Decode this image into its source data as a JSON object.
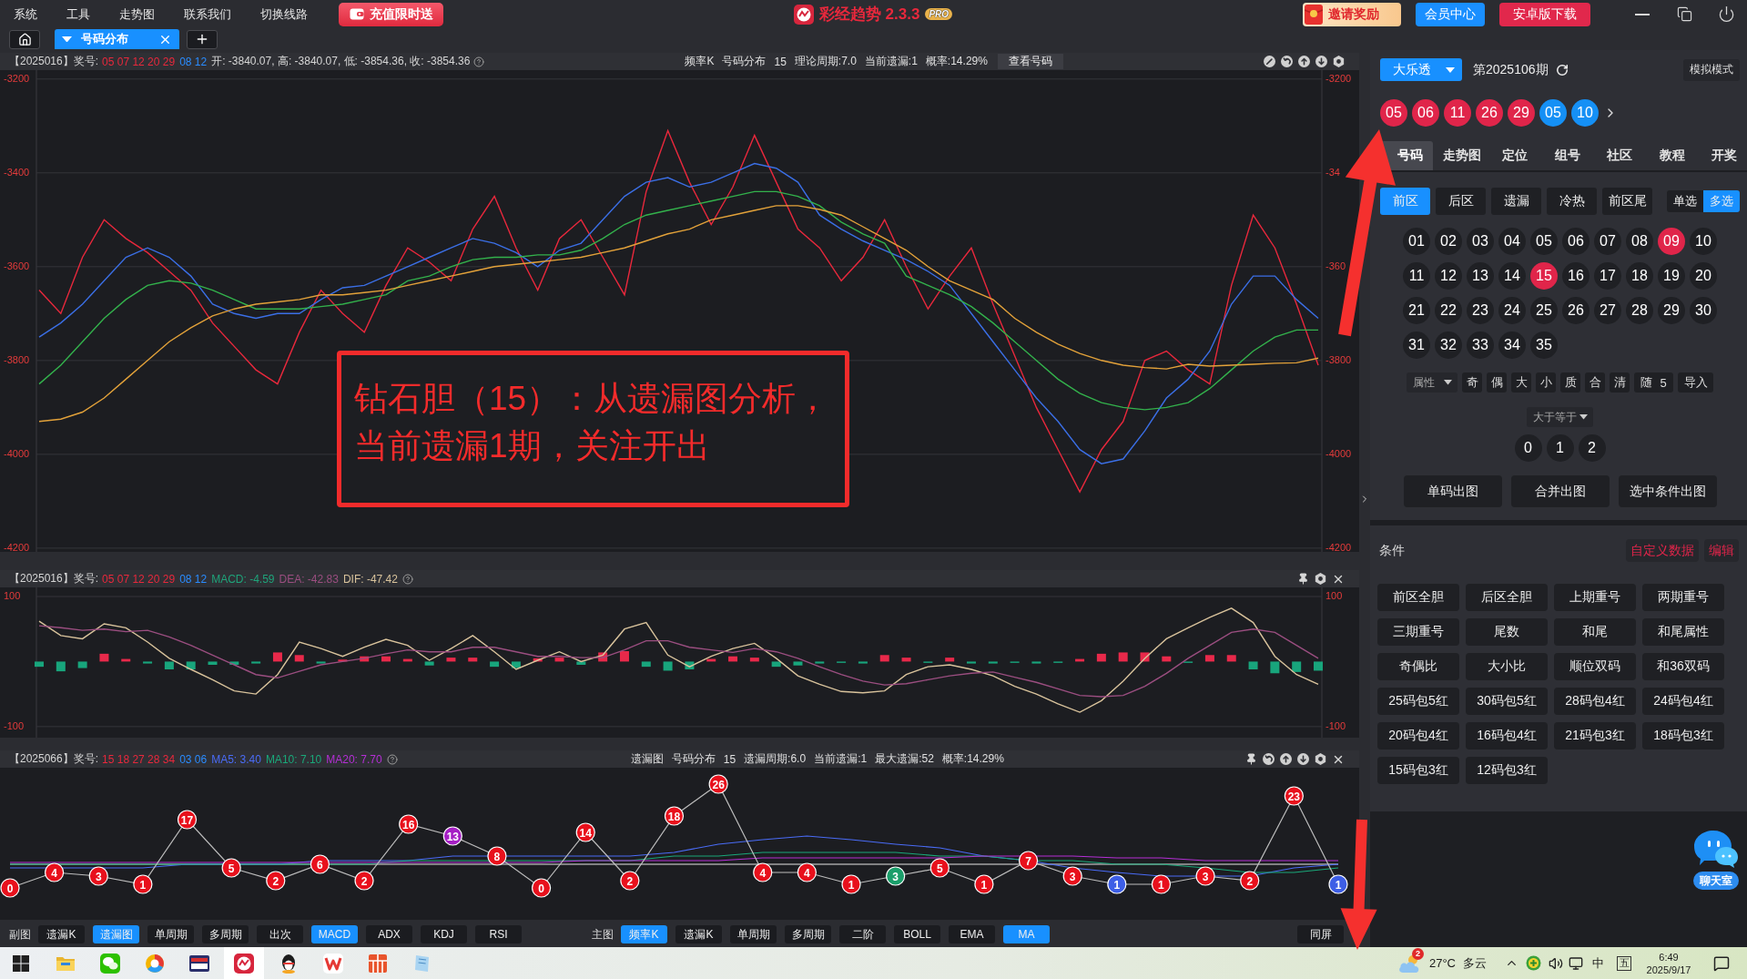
{
  "menu_bar": {
    "items": [
      "系统",
      "工具",
      "走势图",
      "联系我们",
      "切换线路"
    ],
    "promo_button": "充值限时送",
    "logo": {
      "title": "彩经趋势 2.3.3",
      "badge": "PRO"
    },
    "buttons": [
      {
        "label": "邀请奖励",
        "kind": "gift"
      },
      {
        "label": "会员中心",
        "kind": "primary"
      },
      {
        "label": "安卓版下载",
        "kind": "danger"
      }
    ]
  },
  "tab_bar": {
    "tabs": [
      {
        "label": "号码分布",
        "selected": true
      }
    ]
  },
  "chart_panels": [
    {
      "header": {
        "issue": "【2025016】奖号:",
        "front_numbers": "05 07 12 20 29",
        "back_numbers": "08 12",
        "ohlc": "开: -3840.07, 高: -3840.07, 低: -3854.36, 收: -3854.36",
        "info": [
          "频率K",
          "号码分布",
          "15",
          "理论周期:7.0",
          "当前遗漏:1",
          "概率:14.29%"
        ],
        "view_button": "查看号码"
      },
      "chart_data": {
        "type": "line",
        "grid": true,
        "ylim": [
          -4208,
          -3181
        ],
        "yticks": [
          -3200,
          -3400,
          -3600,
          -3800,
          -4000,
          -4200
        ],
        "series": [
          {
            "color": "#e8283c",
            "values": [
              -3650,
              -3700,
              -3580,
              -3500,
              -3540,
              -3570,
              -3610,
              -3650,
              -3720,
              -3770,
              -3820,
              -3850,
              -3740,
              -3650,
              -3700,
              -3740,
              -3640,
              -3560,
              -3590,
              -3630,
              -3520,
              -3450,
              -3560,
              -3650,
              -3540,
              -3500,
              -3580,
              -3660,
              -3440,
              -3310,
              -3420,
              -3510,
              -3430,
              -3320,
              -3420,
              -3520,
              -3560,
              -3630,
              -3580,
              -3500,
              -3600,
              -3690,
              -3620,
              -3560,
              -3680,
              -3790,
              -3900,
              -3990,
              -4080,
              -3990,
              -3930,
              -3800,
              -3780,
              -3820,
              -3850,
              -3640,
              -3490,
              -3560,
              -3680,
              -3810
            ]
          },
          {
            "color": "#3b6fe6",
            "values": [
              -3750,
              -3720,
              -3680,
              -3630,
              -3580,
              -3560,
              -3580,
              -3620,
              -3680,
              -3700,
              -3710,
              -3700,
              -3700,
              -3670,
              -3645,
              -3640,
              -3620,
              -3600,
              -3580,
              -3560,
              -3540,
              -3550,
              -3570,
              -3600,
              -3565,
              -3550,
              -3500,
              -3450,
              -3420,
              -3410,
              -3430,
              -3420,
              -3400,
              -3380,
              -3390,
              -3420,
              -3490,
              -3520,
              -3545,
              -3565,
              -3585,
              -3610,
              -3640,
              -3700,
              -3760,
              -3820,
              -3880,
              -3930,
              -3990,
              -4020,
              -4010,
              -3950,
              -3880,
              -3840,
              -3780,
              -3680,
              -3620,
              -3620,
              -3670,
              -3710
            ]
          },
          {
            "color": "#33b24c",
            "values": [
              -3850,
              -3810,
              -3760,
              -3710,
              -3670,
              -3640,
              -3630,
              -3635,
              -3650,
              -3670,
              -3690,
              -3690,
              -3690,
              -3685,
              -3680,
              -3670,
              -3660,
              -3630,
              -3620,
              -3600,
              -3585,
              -3580,
              -3580,
              -3575,
              -3575,
              -3565,
              -3540,
              -3510,
              -3490,
              -3480,
              -3470,
              -3460,
              -3450,
              -3440,
              -3440,
              -3450,
              -3470,
              -3505,
              -3530,
              -3550,
              -3620,
              -3640,
              -3660,
              -3685,
              -3720,
              -3760,
              -3800,
              -3840,
              -3870,
              -3890,
              -3900,
              -3905,
              -3900,
              -3890,
              -3860,
              -3820,
              -3780,
              -3750,
              -3735,
              -3735
            ]
          },
          {
            "color": "#e3a23a",
            "values": [
              -3930,
              -3925,
              -3910,
              -3880,
              -3840,
              -3800,
              -3760,
              -3730,
              -3705,
              -3690,
              -3680,
              -3675,
              -3670,
              -3660,
              -3660,
              -3655,
              -3650,
              -3640,
              -3630,
              -3620,
              -3610,
              -3600,
              -3595,
              -3590,
              -3585,
              -3580,
              -3570,
              -3560,
              -3545,
              -3530,
              -3520,
              -3500,
              -3490,
              -3480,
              -3470,
              -3470,
              -3478,
              -3490,
              -3515,
              -3540,
              -3565,
              -3600,
              -3630,
              -3650,
              -3670,
              -3710,
              -3740,
              -3765,
              -3785,
              -3800,
              -3810,
              -3815,
              -3818,
              -3808,
              -3812,
              -3810,
              -3808,
              -3806,
              -3805,
              -3795
            ]
          }
        ]
      },
      "right_axis_labels": [
        "-3200",
        "-34",
        "-360",
        "-3800",
        "-4000",
        "-4200"
      ]
    },
    {
      "header": {
        "issue": "【2025016】奖号:",
        "front_numbers": "05 07 12 20 29",
        "back_numbers": "08 12",
        "indicators": [
          {
            "text": "MACD: -4.59",
            "color": "#1fa37a"
          },
          {
            "text": "DEA: -42.83",
            "color": "#9b4e80"
          },
          {
            "text": "DIF: -47.42",
            "color": "#d9c39c"
          }
        ]
      },
      "chart_data": {
        "type": "bar",
        "grid": true,
        "stacked": true,
        "ylim": [
          -117,
          114
        ],
        "yticks": [
          {
            "value": 100,
            "label": "100"
          },
          {
            "value": -100,
            "label": "-100"
          }
        ],
        "series": [
          {
            "color": "#e8294a",
            "values": [
              null,
              null,
              null,
              12,
              4,
              null,
              null,
              null,
              null,
              null,
              null,
              14,
              10,
              null,
              3,
              8,
              8,
              4,
              null,
              6,
              6,
              null,
              null,
              5,
              6,
              null,
              14,
              16,
              null,
              null,
              null,
              4,
              8,
              6,
              null,
              null,
              null,
              null,
              null,
              10,
              6,
              null,
              6,
              null,
              null,
              null,
              null,
              null,
              4,
              12,
              14,
              14,
              8,
              null,
              10,
              10,
              null,
              null,
              null,
              null
            ]
          },
          {
            "color": "#18a57c",
            "values": [
              -8,
              -15,
              -10,
              null,
              null,
              -3,
              -12,
              -12,
              -5,
              -5,
              -3,
              null,
              null,
              -3,
              null,
              null,
              null,
              null,
              -6,
              null,
              null,
              -8,
              -10,
              null,
              null,
              -5,
              null,
              null,
              -8,
              -14,
              -12,
              null,
              null,
              null,
              -8,
              -6,
              -3,
              -2,
              -3,
              null,
              null,
              -2,
              null,
              -3,
              -3,
              -2,
              -3,
              -2,
              null,
              null,
              null,
              null,
              null,
              -2,
              null,
              null,
              -12,
              -18,
              -16,
              -14
            ]
          },
          {
            "type": "line",
            "color": "#d9c39c",
            "values": [
              62,
              40,
              35,
              58,
              52,
              30,
              5,
              -12,
              -28,
              -45,
              -50,
              -20,
              30,
              20,
              8,
              22,
              34,
              25,
              2,
              20,
              40,
              15,
              -12,
              2,
              15,
              0,
              10,
              50,
              60,
              10,
              -8,
              8,
              20,
              28,
              5,
              -22,
              -35,
              -46,
              -48,
              -45,
              -20,
              -8,
              -5,
              -12,
              -22,
              -38,
              -50,
              -65,
              -78,
              -60,
              -30,
              5,
              35,
              52,
              68,
              82,
              60,
              8,
              -20,
              -35
            ]
          },
          {
            "type": "line",
            "color": "#9b4e80",
            "values": [
              55,
              52,
              48,
              50,
              46,
              48,
              38,
              25,
              10,
              -5,
              -20,
              -25,
              -15,
              -5,
              0,
              5,
              12,
              18,
              15,
              15,
              22,
              22,
              15,
              8,
              8,
              6,
              6,
              18,
              32,
              32,
              22,
              18,
              14,
              20,
              15,
              5,
              -8,
              -20,
              -30,
              -36,
              -34,
              -28,
              -22,
              -18,
              -16,
              -24,
              -32,
              -42,
              -52,
              -54,
              -52,
              -38,
              -18,
              5,
              25,
              45,
              50,
              45,
              25,
              5
            ]
          }
        ]
      },
      "right_axis_labels": [
        "100",
        "-100"
      ]
    },
    {
      "header": {
        "issue": "【2025066】奖号:",
        "front_numbers": "15 18 27 28 34",
        "back_numbers": "03 06",
        "indicators": [
          {
            "text": "MA5: 3.40",
            "color": "#4a6cf7"
          },
          {
            "text": "MA10: 7.10",
            "color": "#1aa87a"
          },
          {
            "text": "MA20: 7.70",
            "color": "#b52fd6"
          }
        ],
        "info": [
          "遗漏图",
          "号码分布",
          "15",
          "遗漏周期:6.0",
          "当前遗漏:1",
          "最大遗漏:52",
          "概率:14.29%"
        ]
      },
      "omission_chart": {
        "points": [
          {
            "label": "0",
            "color": "#e8101c"
          },
          {
            "label": "4",
            "color": "#e8101c"
          },
          {
            "label": "3",
            "color": "#e8101c"
          },
          {
            "label": "1",
            "color": "#e8101c"
          },
          {
            "label": "17",
            "color": "#e8101c"
          },
          {
            "label": "5",
            "color": "#e8101c"
          },
          {
            "label": "2",
            "color": "#e8101c"
          },
          {
            "label": "6",
            "color": "#e8101c"
          },
          {
            "label": "2",
            "color": "#e8101c"
          },
          {
            "label": "16",
            "color": "#e8101c"
          },
          {
            "label": "13",
            "color": "#a51fc4"
          },
          {
            "label": "8",
            "color": "#e8101c"
          },
          {
            "label": "0",
            "color": "#e8101c"
          },
          {
            "label": "14",
            "color": "#e8101c"
          },
          {
            "label": "2",
            "color": "#e8101c"
          },
          {
            "label": "18",
            "color": "#e8101c"
          },
          {
            "label": "26",
            "color": "#e8101c"
          },
          {
            "label": "4",
            "color": "#e8101c"
          },
          {
            "label": "4",
            "color": "#e8101c"
          },
          {
            "label": "1",
            "color": "#e8101c"
          },
          {
            "label": "3",
            "color": "#1a9e6a"
          },
          {
            "label": "5",
            "color": "#e8101c"
          },
          {
            "label": "1",
            "color": "#e8101c"
          },
          {
            "label": "7",
            "color": "#e8101c"
          },
          {
            "label": "3",
            "color": "#e8101c"
          },
          {
            "label": "1",
            "color": "#3d5ee6"
          },
          {
            "label": "1",
            "color": "#e8101c"
          },
          {
            "label": "3",
            "color": "#e8101c"
          },
          {
            "label": "2",
            "color": "#e8101c"
          },
          {
            "label": "23",
            "color": "#e8101c"
          },
          {
            "label": "1",
            "color": "#3d5ee6"
          }
        ]
      }
    }
  ],
  "annotation": {
    "text": "钻石胆（15）：从遗漏图分析，当前遗漏1期，关注开出"
  },
  "bottom_toolbar": {
    "groups": [
      {
        "label": "副图",
        "buttons": [
          {
            "label": "遗漏K",
            "selected": false
          },
          {
            "label": "遗漏图",
            "selected": true
          },
          {
            "label": "单周期",
            "selected": false
          },
          {
            "label": "多周期",
            "selected": false
          },
          {
            "label": "出次",
            "selected": false
          },
          {
            "label": "MACD",
            "selected": true
          },
          {
            "label": "ADX",
            "selected": false
          },
          {
            "label": "KDJ",
            "selected": false
          },
          {
            "label": "RSI",
            "selected": false
          }
        ]
      },
      {
        "label": "主图",
        "buttons": [
          {
            "label": "频率K",
            "selected": true
          },
          {
            "label": "遗漏K",
            "selected": false
          },
          {
            "label": "单周期",
            "selected": false
          },
          {
            "label": "多周期",
            "selected": false
          },
          {
            "label": "二阶",
            "selected": false
          },
          {
            "label": "BOLL",
            "selected": false
          },
          {
            "label": "EMA",
            "selected": false
          },
          {
            "label": "MA",
            "selected": true
          }
        ]
      }
    ],
    "sync_button": "同屏"
  },
  "side_panel": {
    "game_select": "大乐透",
    "issue": "第2025106期",
    "mode_button": "模拟模式",
    "draw_balls": [
      {
        "number": "05",
        "kind": "front"
      },
      {
        "number": "06",
        "kind": "front"
      },
      {
        "number": "11",
        "kind": "front"
      },
      {
        "number": "26",
        "kind": "front"
      },
      {
        "number": "29",
        "kind": "front"
      },
      {
        "number": "05",
        "kind": "back"
      },
      {
        "number": "10",
        "kind": "back"
      }
    ],
    "tabs": [
      {
        "label": "号码",
        "selected": true
      },
      {
        "label": "走势图",
        "selected": false
      },
      {
        "label": "定位",
        "selected": false
      },
      {
        "label": "组号",
        "selected": false
      },
      {
        "label": "社区",
        "selected": false
      },
      {
        "label": "教程",
        "selected": false
      },
      {
        "label": "开奖",
        "selected": false
      }
    ],
    "zone_tabs": [
      {
        "label": "前区",
        "selected": true
      },
      {
        "label": "后区",
        "selected": false
      },
      {
        "label": "遗漏",
        "selected": false
      },
      {
        "label": "冷热",
        "selected": false
      },
      {
        "label": "前区尾",
        "selected": false
      }
    ],
    "select_modes": [
      {
        "label": "单选",
        "selected": false
      },
      {
        "label": "多选",
        "selected": true
      }
    ],
    "numbers": [
      {
        "label": "01",
        "selected": false
      },
      {
        "label": "02",
        "selected": false
      },
      {
        "label": "03",
        "selected": false
      },
      {
        "label": "04",
        "selected": false
      },
      {
        "label": "05",
        "selected": false
      },
      {
        "label": "06",
        "selected": false
      },
      {
        "label": "07",
        "selected": false
      },
      {
        "label": "08",
        "selected": false
      },
      {
        "label": "09",
        "selected": true
      },
      {
        "label": "10",
        "selected": false
      },
      {
        "label": "11",
        "selected": false
      },
      {
        "label": "12",
        "selected": false
      },
      {
        "label": "13",
        "selected": false
      },
      {
        "label": "14",
        "selected": false
      },
      {
        "label": "15",
        "selected": true
      },
      {
        "label": "16",
        "selected": false
      },
      {
        "label": "17",
        "selected": false
      },
      {
        "label": "18",
        "selected": false
      },
      {
        "label": "19",
        "selected": false
      },
      {
        "label": "20",
        "selected": false
      },
      {
        "label": "21",
        "selected": false
      },
      {
        "label": "22",
        "selected": false
      },
      {
        "label": "23",
        "selected": false
      },
      {
        "label": "24",
        "selected": false
      },
      {
        "label": "25",
        "selected": false
      },
      {
        "label": "26",
        "selected": false
      },
      {
        "label": "27",
        "selected": false
      },
      {
        "label": "28",
        "selected": false
      },
      {
        "label": "29",
        "selected": false
      },
      {
        "label": "30",
        "selected": false
      },
      {
        "label": "31",
        "selected": false
      },
      {
        "label": "32",
        "selected": false
      },
      {
        "label": "33",
        "selected": false
      },
      {
        "label": "34",
        "selected": false
      },
      {
        "label": "35",
        "selected": false
      }
    ],
    "filter": {
      "dropdown": "属性",
      "buttons": [
        "奇",
        "偶",
        "大",
        "小",
        "质",
        "合",
        "清"
      ],
      "random": {
        "label": "随",
        "count": "5"
      },
      "import_button": "导入"
    },
    "compare": {
      "dropdown": "大于等于",
      "options": [
        {
          "label": "0",
          "selected": false
        },
        {
          "label": "1",
          "selected": false
        },
        {
          "label": "2",
          "selected": false
        }
      ]
    },
    "action_buttons": [
      "单码出图",
      "合并出图",
      "选中条件出图"
    ],
    "conditions": {
      "title": "条件",
      "links": [
        "自定义数据",
        "编辑"
      ],
      "buttons": [
        "前区全胆",
        "后区全胆",
        "上期重号",
        "两期重号",
        "三期重号",
        "尾数",
        "和尾",
        "和尾属性",
        "奇偶比",
        "大小比",
        "顺位双码",
        "和36双码",
        "25码包5红",
        "30码包5红",
        "28码包4红",
        "24码包4红",
        "20码包4红",
        "16码包4红",
        "21码包3红",
        "18码包3红",
        "15码包3红",
        "12码包3红"
      ]
    },
    "chat_button": "聊天室"
  },
  "taskbar": {
    "apps": [
      {
        "selected": false
      },
      {
        "selected": false
      },
      {
        "selected": false
      },
      {
        "selected": false
      },
      {
        "selected": false
      },
      {
        "selected": true
      },
      {
        "selected": false
      },
      {
        "selected": false
      },
      {
        "selected": false
      },
      {
        "selected": false
      }
    ],
    "weather": {
      "badge": "2",
      "temperature": "27°C",
      "condition": "多云"
    },
    "input_method": "中",
    "keyboard_layout": "五",
    "clock": {
      "time": "6:49",
      "date": "2025/9/17"
    }
  }
}
